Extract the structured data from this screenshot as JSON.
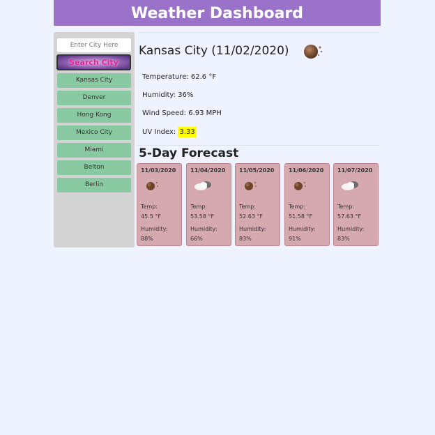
{
  "header": {
    "title": "Weather Dashboard"
  },
  "sidebar": {
    "search_placeholder": "Enter City Here",
    "search_button": "Search City",
    "history": [
      "Kansas City",
      "Denver",
      "Hong Kong",
      "Mexico City",
      "Miami",
      "Belton",
      "Berlin"
    ]
  },
  "current": {
    "title": "Kansas City (11/02/2020)",
    "icon": "clear-night-icon",
    "temperature": "Temperature: 62.6 °F",
    "humidity": "Humidity: 36%",
    "wind": "Wind Speed: 6.93 MPH",
    "uv_label": "UV Index:",
    "uv_value": "3.33",
    "uv_color": "#ffff00"
  },
  "forecast": {
    "title": "5-Day Forecast",
    "days": [
      {
        "date": "11/03/2020",
        "icon": "clear-night-icon",
        "temp_label": "Temp:",
        "temp": "45.5 °F",
        "humidity_label": "Humidity:",
        "humidity": "88%"
      },
      {
        "date": "11/04/2020",
        "icon": "cloudy-icon",
        "temp_label": "Temp:",
        "temp": "53.58 °F",
        "humidity_label": "Humidity:",
        "humidity": "66%"
      },
      {
        "date": "11/05/2020",
        "icon": "clear-night-icon",
        "temp_label": "Temp:",
        "temp": "52.63 °F",
        "humidity_label": "Humidity:",
        "humidity": "83%"
      },
      {
        "date": "11/06/2020",
        "icon": "clear-night-icon",
        "temp_label": "Temp:",
        "temp": "51.58 °F",
        "humidity_label": "Humidity:",
        "humidity": "91%"
      },
      {
        "date": "11/07/2020",
        "icon": "cloudy-icon",
        "temp_label": "Temp:",
        "temp": "57.63 °F",
        "humidity_label": "Humidity:",
        "humidity": "83%"
      }
    ]
  },
  "colors": {
    "header": "#9b72c9",
    "sidebar": "#d3d3d3",
    "history_item": "#88c9a1",
    "card": "#d6a8b0",
    "page_bg": "#eef3ff"
  }
}
